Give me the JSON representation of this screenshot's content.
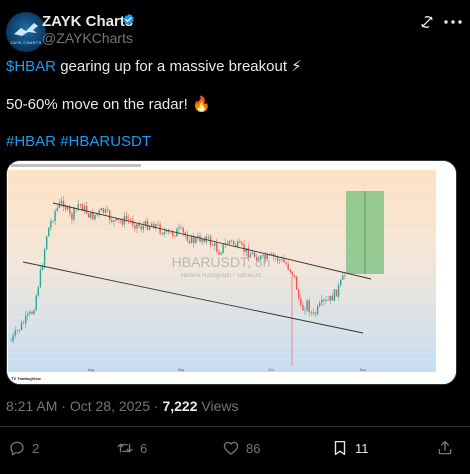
{
  "author": {
    "name": "ZAYK Charts",
    "handle": "@ZAYKCharts",
    "avatar_text": "ZAYK CHARTS",
    "verified": true
  },
  "post": {
    "line1": {
      "cashtag": "$HBAR",
      "text": " gearing up for a massive breakout ⚡"
    },
    "line2": "50-60% move on the radar! 🔥",
    "hashtags": [
      "#HBAR",
      "#HBARUSDT"
    ]
  },
  "chart": {
    "watermark_symbol": "HBARUSDT, 8h",
    "watermark_name": "Hedera Hashgraph / TetherUS",
    "footer_brand": "TV TradingView",
    "month_labels": [
      "Aug",
      "Sep",
      "Oct",
      "Nov"
    ]
  },
  "meta": {
    "time": "8:21 AM",
    "separator": " · ",
    "date": "Oct 28, 2025",
    "views_count": "7,222",
    "views_label": " Views"
  },
  "actions": {
    "replies": "2",
    "reposts": "6",
    "likes": "86",
    "bookmarks": "11"
  },
  "colors": {
    "accent": "#1d9bf0",
    "background": "#000000",
    "muted": "#71767b",
    "candle_up": "#26a69a",
    "candle_down": "#ef5350"
  },
  "icons": [
    "verified-badge-icon",
    "grok-icon",
    "more-icon",
    "reply-icon",
    "repost-icon",
    "like-icon",
    "bookmark-icon",
    "share-icon"
  ]
}
